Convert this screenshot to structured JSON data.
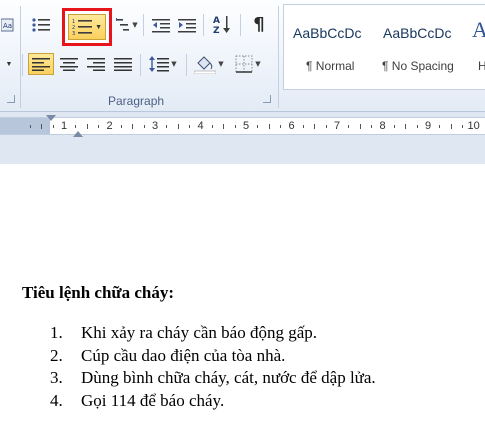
{
  "ribbon": {
    "group_label": "Paragraph",
    "sort_label": "A↓Z",
    "pilcrow_label": "¶"
  },
  "styles": [
    {
      "sample": "AaBbCcDc",
      "name": "¶ Normal"
    },
    {
      "sample": "AaBbCcDc",
      "name": "¶ No Spacing"
    },
    {
      "sample": "A",
      "name": "H"
    }
  ],
  "ruler": {
    "labels": [
      "1",
      "2",
      "3",
      "4",
      "5",
      "6",
      "7",
      "8",
      "9",
      "10"
    ]
  },
  "document": {
    "heading": "Tiêu lệnh chữa cháy:",
    "items": [
      {
        "num": "1.",
        "text": "Khi xảy ra cháy cần báo động gấp."
      },
      {
        "num": "2.",
        "text": "Cúp cầu dao điện của tòa nhà."
      },
      {
        "num": "3.",
        "text": "Dùng bình chữa cháy, cát, nước để dập lửa."
      },
      {
        "num": "4.",
        "text": "Gọi 114 để báo cháy."
      }
    ]
  },
  "colors": {
    "highlight_border": "#e8141b",
    "active_button": "#fbd05c",
    "group_label": "#4d6185"
  }
}
